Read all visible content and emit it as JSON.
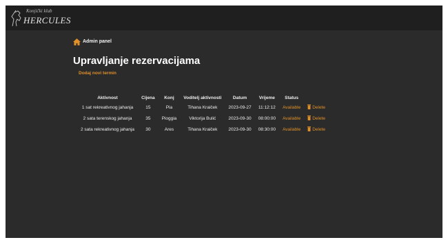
{
  "header": {
    "club_label": "Konjički klub",
    "brand_name": "HERCULES"
  },
  "breadcrumb": {
    "label": "Admin panel",
    "icon": "home-icon"
  },
  "page": {
    "title": "Upravljanje rezervacijama",
    "add_link": "Dodaj novi termin"
  },
  "colors": {
    "accent": "#e0902a",
    "background": "#2b2b2b",
    "topbar": "#1f1f1f"
  },
  "table": {
    "headers": [
      "Aktivnost",
      "Cijena",
      "Konj",
      "Voditelj aktivnosti",
      "Datum",
      "Vrijeme",
      "Status"
    ],
    "rows": [
      {
        "activity": "1 sat rekreativnog jahanja",
        "price": "15",
        "horse": "Pia",
        "leader": "Tihana Kraiček",
        "date": "2023-09-27",
        "time": "11:12:12",
        "status": "Available",
        "action": "Delete"
      },
      {
        "activity": "2 sata terenskog jahanja",
        "price": "35",
        "horse": "Pioggia",
        "leader": "Viktorija Bulić",
        "date": "2023-09-30",
        "time": "08:00:00",
        "status": "Available",
        "action": "Delete"
      },
      {
        "activity": "2 sata rekreativnog jahanja",
        "price": "30",
        "horse": "Ares",
        "leader": "Tihana Kraiček",
        "date": "2023-09-30",
        "time": "08:30:00",
        "status": "Available",
        "action": "Delete"
      }
    ]
  }
}
